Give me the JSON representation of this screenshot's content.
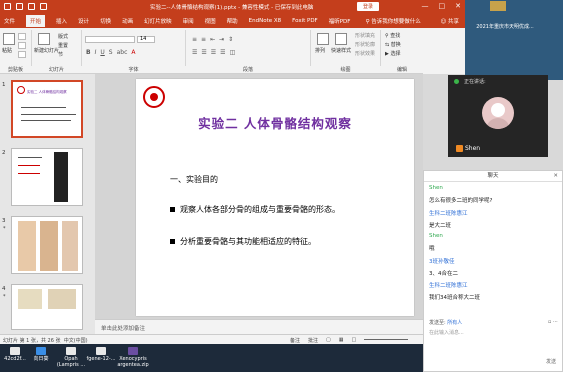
{
  "titlebar": {
    "doc_title": "实验二--人体骨骼结构观察(1).pptx - 兼容性模式 - 已保存到此电脑",
    "login": "登录",
    "controls": [
      "—",
      "□",
      "✕"
    ]
  },
  "menubar": {
    "tabs": [
      "文件",
      "开始",
      "插入",
      "设计",
      "切换",
      "动画",
      "幻灯片放映",
      "审阅",
      "视图",
      "帮助",
      "EndNote X8",
      "Foxit PDF",
      "福昕PDF"
    ],
    "active_index": 1,
    "tell_me": "告诉我你想要做什么",
    "share": "共享"
  },
  "ribbon": {
    "clipboard": {
      "paste": "粘贴",
      "label": "剪贴板"
    },
    "slides": {
      "new_slide": "新建幻灯片",
      "layout": "版式",
      "reset": "重置",
      "section": "节",
      "label": "幻灯片"
    },
    "font": {
      "label": "字体",
      "size": "14"
    },
    "paragraph": {
      "label": "段落"
    },
    "drawing": {
      "arrange": "排列",
      "quick_styles": "快速样式",
      "shape_fill": "形状填充",
      "shape_outline": "形状轮廓",
      "shape_effects": "形状效果",
      "label": "绘图"
    },
    "editing": {
      "find": "查找",
      "replace": "替换",
      "select": "选择",
      "label": "编辑"
    }
  },
  "thumbnails": [
    {
      "num": "1",
      "star": "",
      "caption": "实验二 人体骨骼结构观察",
      "selected": true
    },
    {
      "num": "2",
      "star": "",
      "caption": "",
      "selected": false
    },
    {
      "num": "3",
      "star": "*",
      "caption": "",
      "selected": false
    },
    {
      "num": "4",
      "star": "*",
      "caption": "",
      "selected": false
    }
  ],
  "slide": {
    "title": "实验二  人体骨骼结构观察",
    "subtitle": "一、实验目的",
    "bullets": [
      "观察人体各部分骨的组成与重要骨骼的形态。",
      "分析重要骨骼与其功能相适应的特征。"
    ]
  },
  "notes_placeholder": "单击此处添加备注",
  "statusbar": {
    "slide_info": "幻灯片 第 1 张，共 26 张",
    "language": "中文(中国)",
    "notes": "备注",
    "comments": "批注"
  },
  "taskbar": {
    "items": [
      "42cd2f...",
      "向日葵",
      "Opah (Lampris ...",
      "fgene-12-...",
      "Xenocypris argentea.zip"
    ]
  },
  "desktop": {
    "icon_label": "2021年重庆市天明优成..."
  },
  "video": {
    "label": "正在讲话:",
    "name": "Shen"
  },
  "chat": {
    "header": "聊天",
    "messages": [
      {
        "sender": "Shen",
        "text": "怎么有很多二班的同学呢?",
        "color": "green"
      },
      {
        "sender": "生科二班陈惠江",
        "text": "是大二班",
        "color": "blue"
      },
      {
        "sender": "Shen",
        "text": "哦",
        "color": "green"
      },
      {
        "sender": "3班孙敬佳",
        "text": "3、4合在二",
        "color": "blue"
      },
      {
        "sender": "生科二班陈惠江",
        "text": "我们34班合称大二班",
        "color": "blue"
      }
    ],
    "send_to_label": "发送至:",
    "send_to_value": "所有人",
    "input_placeholder": "在此输入消息...",
    "send_button": "发送"
  }
}
